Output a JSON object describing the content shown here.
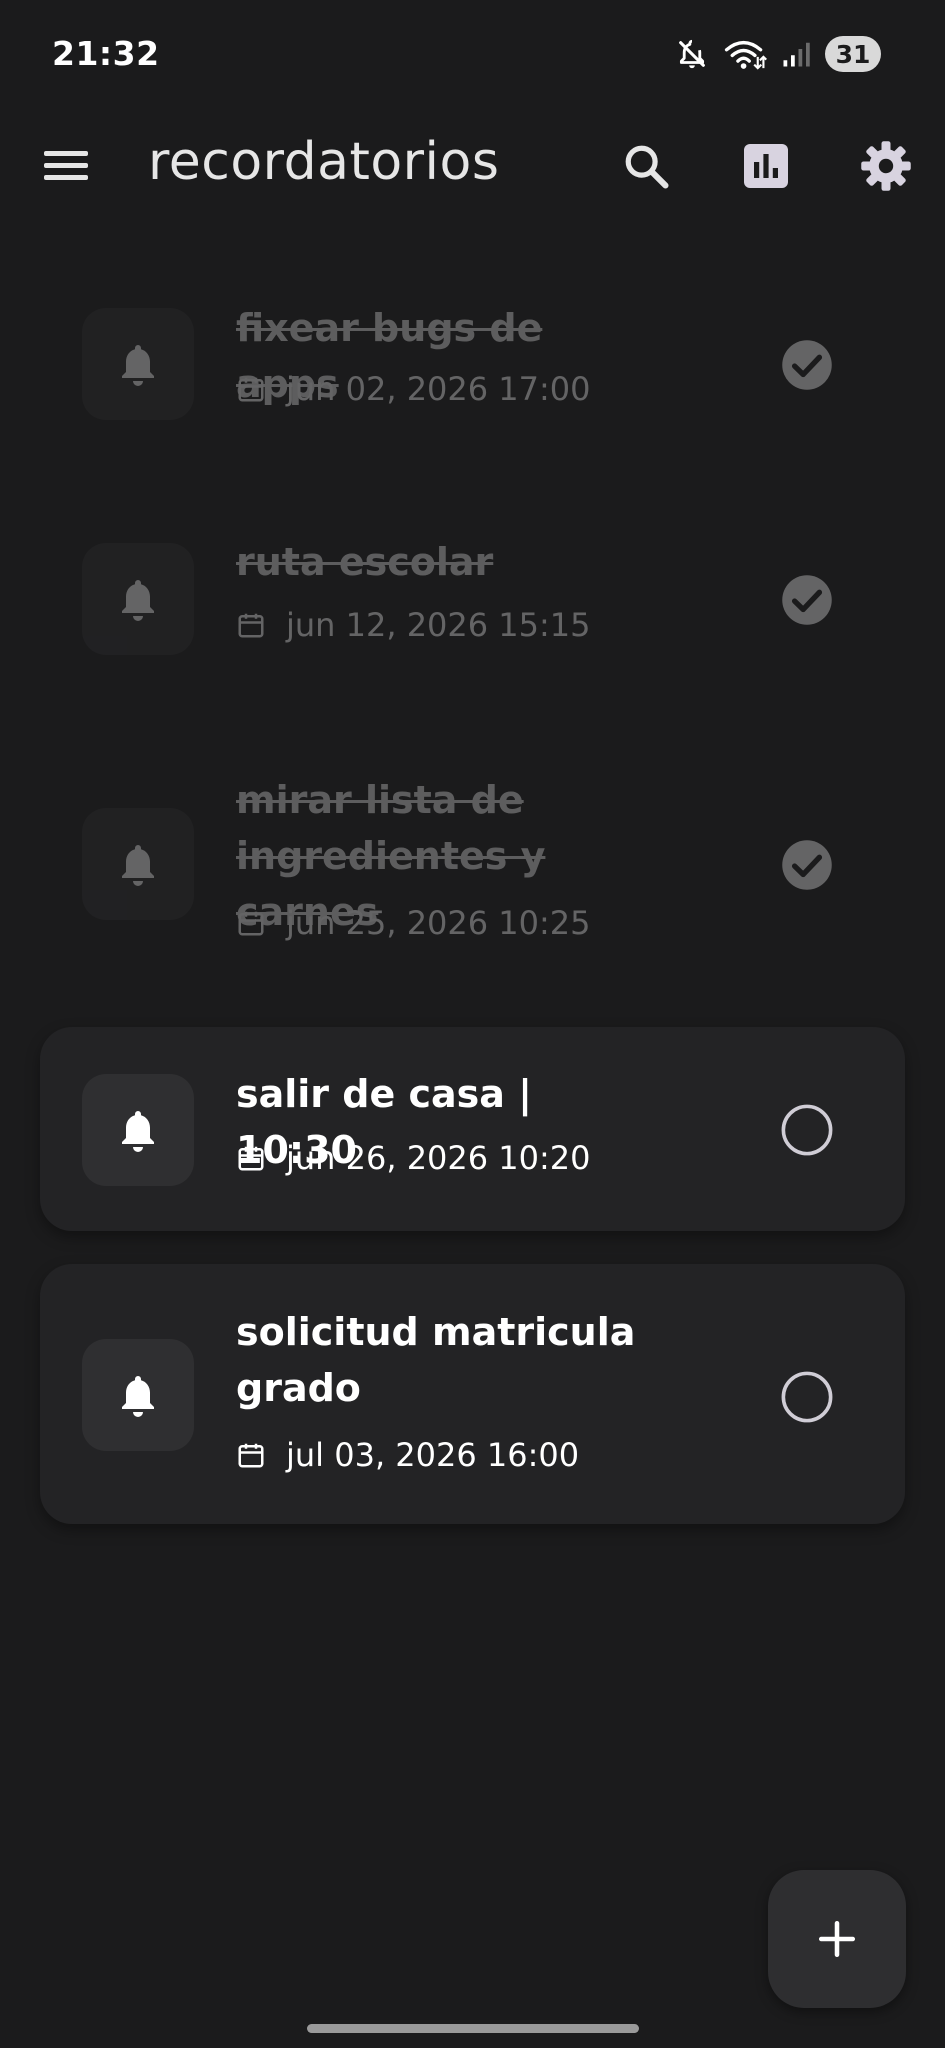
{
  "status_bar": {
    "time": "21:32",
    "battery": "31",
    "icons": [
      "mute-icon",
      "wifi-icon",
      "signal-icon"
    ]
  },
  "app_bar": {
    "title": "recordatorios",
    "icons": [
      "menu-icon",
      "search-icon",
      "bar-chart-icon",
      "gear-icon"
    ]
  },
  "reminders": [
    {
      "title": "fixear bugs de apps",
      "date": "jun 02, 2026 17:00",
      "completed": true
    },
    {
      "title": "ruta escolar",
      "date": "jun 12, 2026 15:15",
      "completed": true
    },
    {
      "title": "mirar lista de ingredientes y carnes",
      "date": "jun 25, 2026 10:25",
      "completed": true
    },
    {
      "title": "salir de casa | 10:30",
      "date": "jun 26, 2026 10:20",
      "completed": false
    },
    {
      "title": "solicitud matricula grado",
      "date": "jul 03, 2026 16:00",
      "completed": false
    }
  ],
  "fab": {
    "icon": "plus-icon"
  },
  "colors": {
    "background": "#1b1b1c",
    "card": "#232325",
    "icon_box": "#2f2f31",
    "accent_icon": "#d8d3e0"
  }
}
